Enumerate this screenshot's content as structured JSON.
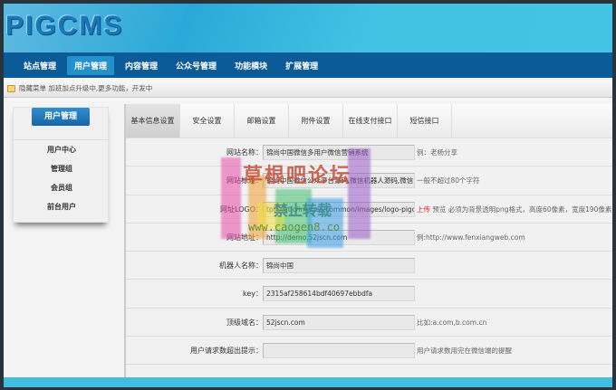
{
  "header": {
    "logo": "PIGCMS"
  },
  "nav": {
    "items": [
      {
        "label": "站点管理"
      },
      {
        "label": "用户管理",
        "active": true
      },
      {
        "label": "内容管理"
      },
      {
        "label": "公众号管理"
      },
      {
        "label": "功能模块"
      },
      {
        "label": "扩展管理"
      }
    ]
  },
  "notice": {
    "text": "隐藏菜单 加班加点升级中,更多功能，开发中"
  },
  "sidebar": {
    "title": "用户管理",
    "items": [
      "用户中心",
      "管理组",
      "会员组",
      "前台用户"
    ]
  },
  "tabs": [
    "基本信息设置",
    "安全设置",
    "邮箱设置",
    "附件设置",
    "在线支付接口",
    "短信接口"
  ],
  "form": [
    {
      "label": "网站名称：",
      "value": "锦尚中国微信多用户微信营销系统",
      "hint": "例：老杨分享"
    },
    {
      "label": "网站标题：",
      "value": "锦尚中国微信公众平台源码,微信机器人源码,微信",
      "hint": "一般不超过80个字符"
    },
    {
      "label": "网址LOGO：",
      "value": "tpl/static/images/common/images/logo-pigcms",
      "upload": "上传",
      "hint": "预览  必须为背景透明png格式，高度60像素，宽度190像素"
    },
    {
      "label": "网站地址：",
      "value": "http://demo.52jscn.com",
      "hint": "例:http://www.fenxiangweb.com"
    },
    {
      "label": "机器人名称：",
      "value": "锦尚中国",
      "hint": ""
    },
    {
      "label": "key：",
      "value": "2315af258614bdf40697ebbdfa",
      "hint": ""
    },
    {
      "label": "顶级域名：",
      "value": "52jscn.com",
      "hint": "比如:a.com,b.com.cn"
    },
    {
      "label": "用户请求数超出提示：",
      "value": "",
      "hint": "用户请求数用完在微信端的提醒"
    }
  ],
  "watermark": {
    "line1": "草根吧论坛",
    "line2": "禁止转载",
    "line3": "www.caogen8.co"
  },
  "colors": {
    "nav": "#0b5b99",
    "header": "#43c2e4",
    "accent": "#2490cc",
    "upload": "#e02020"
  }
}
